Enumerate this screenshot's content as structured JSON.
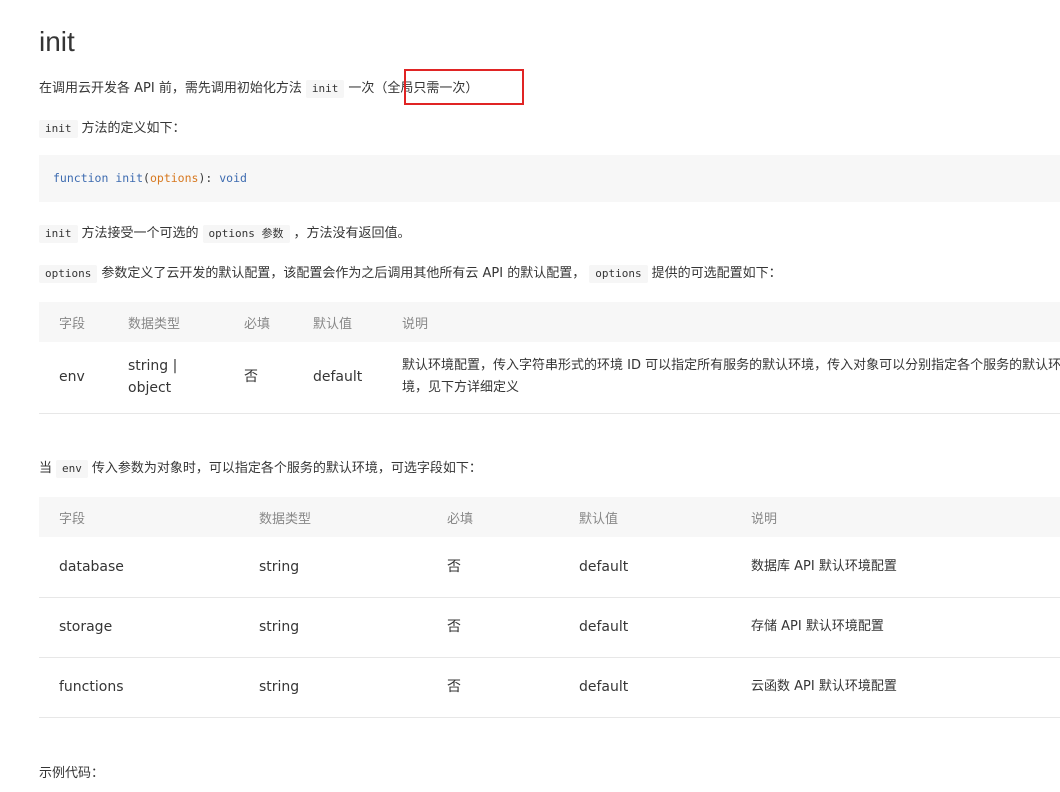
{
  "title": "init",
  "intro": {
    "before": "在调用云开发各 API 前，需先调用初始化方法",
    "code": "init",
    "after": "一次",
    "note": "（全局只需一次）"
  },
  "definition": {
    "code": "init",
    "text": "方法的定义如下："
  },
  "code_sample": {
    "keyword": "function",
    "name": "init",
    "open": "(",
    "param": "options",
    "close": "):",
    "return_type": "void"
  },
  "accepts": {
    "code1": "init",
    "text1": "方法接受一个可选的",
    "code2": "options 参数",
    "text2": "，方法没有返回值。"
  },
  "options_desc": {
    "code1": "options",
    "text1": "参数定义了云开发的默认配置，该配置会作为之后调用其他所有云 API 的默认配置，",
    "code2": "options",
    "text2": "提供的可选配置如下："
  },
  "table1": {
    "headers": [
      "字段",
      "数据类型",
      "必填",
      "默认值",
      "说明"
    ],
    "rows": [
      {
        "field": "env",
        "type": "string | object",
        "required": "否",
        "default": "default",
        "desc": "默认环境配置，传入字符串形式的环境 ID 可以指定所有服务的默认环境，传入对象可以分别指定各个服务的默认环境，见下方详细定义"
      }
    ]
  },
  "env_desc": {
    "text1": "当",
    "code": "env",
    "text2": "传入参数为对象时，可以指定各个服务的默认环境，可选字段如下："
  },
  "table2": {
    "headers": [
      "字段",
      "数据类型",
      "必填",
      "默认值",
      "说明"
    ],
    "rows": [
      {
        "field": "database",
        "type": "string",
        "required": "否",
        "default": "default",
        "desc": "数据库 API 默认环境配置"
      },
      {
        "field": "storage",
        "type": "string",
        "required": "否",
        "default": "default",
        "desc": "存储 API 默认环境配置"
      },
      {
        "field": "functions",
        "type": "string",
        "required": "否",
        "default": "default",
        "desc": "云函数 API 默认环境配置"
      }
    ]
  },
  "example_label": "示例代码："
}
